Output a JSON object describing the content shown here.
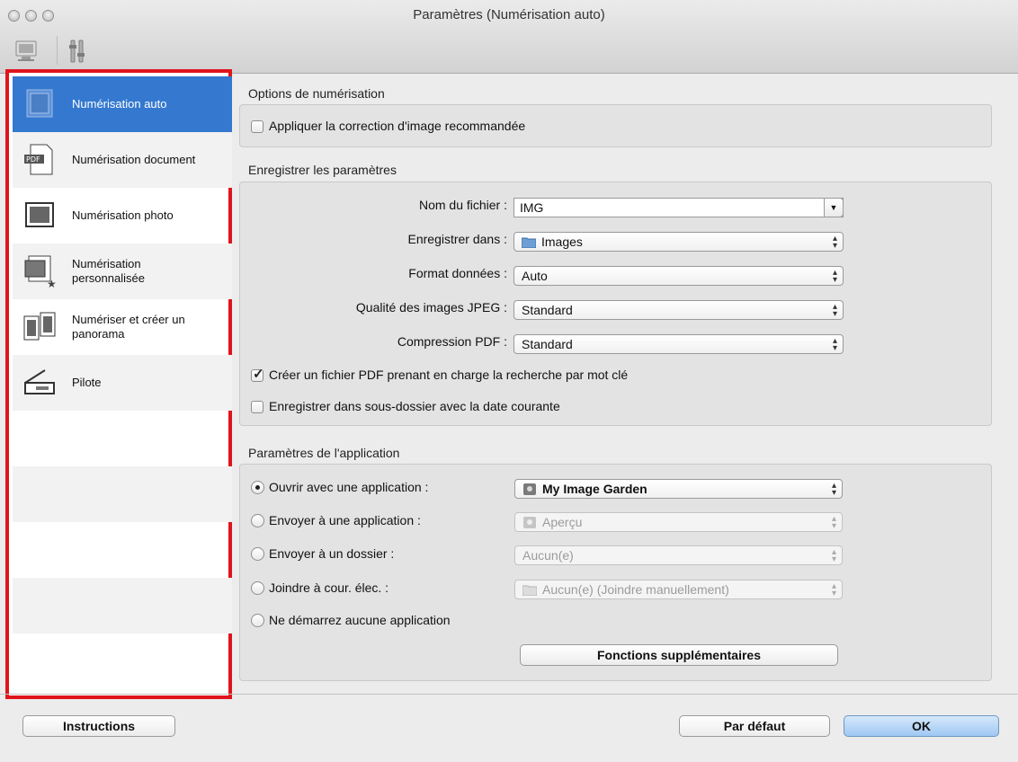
{
  "window": {
    "title": "Paramètres (Numérisation auto)"
  },
  "toolbar": {
    "items": [
      {
        "icon": "scan-from-computer-icon"
      },
      {
        "icon": "general-settings-icon"
      }
    ]
  },
  "sidebar": {
    "items": [
      {
        "label": "Numérisation auto",
        "icon": "auto-scan-icon",
        "selected": true
      },
      {
        "label": "Numérisation document",
        "icon": "pdf-document-icon",
        "selected": false
      },
      {
        "label": "Numérisation photo",
        "icon": "photo-scan-icon",
        "selected": false
      },
      {
        "label": "Numérisation\npersonnalisée",
        "icon": "custom-scan-icon",
        "selected": false
      },
      {
        "label": "Numériser et créer un\npanorama",
        "icon": "panorama-icon",
        "selected": false
      },
      {
        "label": "Pilote",
        "icon": "scanner-driver-icon",
        "selected": false
      }
    ]
  },
  "scan_options": {
    "title": "Options de numérisation",
    "apply_correction": {
      "label": "Appliquer la correction d'image recommandée",
      "checked": false
    }
  },
  "save_settings": {
    "title": "Enregistrer les paramètres",
    "file_name": {
      "label": "Nom du fichier :",
      "value": "IMG"
    },
    "save_in": {
      "label": "Enregistrer dans :",
      "value": "Images"
    },
    "data_format": {
      "label": "Format données :",
      "value": "Auto"
    },
    "jpeg_quality": {
      "label": "Qualité des images JPEG :",
      "value": "Standard"
    },
    "pdf_compression": {
      "label": "Compression PDF :",
      "value": "Standard"
    },
    "keyword_pdf": {
      "label": "Créer un fichier PDF prenant en charge la recherche par mot clé",
      "checked": true
    },
    "date_subfolder": {
      "label": "Enregistrer dans sous-dossier avec la date courante",
      "checked": false
    }
  },
  "app_settings": {
    "title": "Paramètres de l'application",
    "open_with": {
      "label": "Ouvrir avec une application :",
      "value": "My Image Garden",
      "selected": true
    },
    "send_to_app": {
      "label": "Envoyer à une application :",
      "value": "Aperçu",
      "selected": false
    },
    "send_to_folder": {
      "label": "Envoyer à un dossier :",
      "value": "Aucun(e)",
      "selected": false
    },
    "attach_email": {
      "label": "Joindre à cour. élec. :",
      "value": "Aucun(e) (Joindre manuellement)",
      "selected": false
    },
    "no_app": {
      "label": "Ne démarrez aucune application",
      "selected": false
    },
    "more_functions_label": "Fonctions supplémentaires"
  },
  "footer": {
    "instructions_label": "Instructions",
    "defaults_label": "Par défaut",
    "ok_label": "OK"
  },
  "colors": {
    "selection": "#3478cf",
    "highlight_frame": "#e0141c"
  }
}
